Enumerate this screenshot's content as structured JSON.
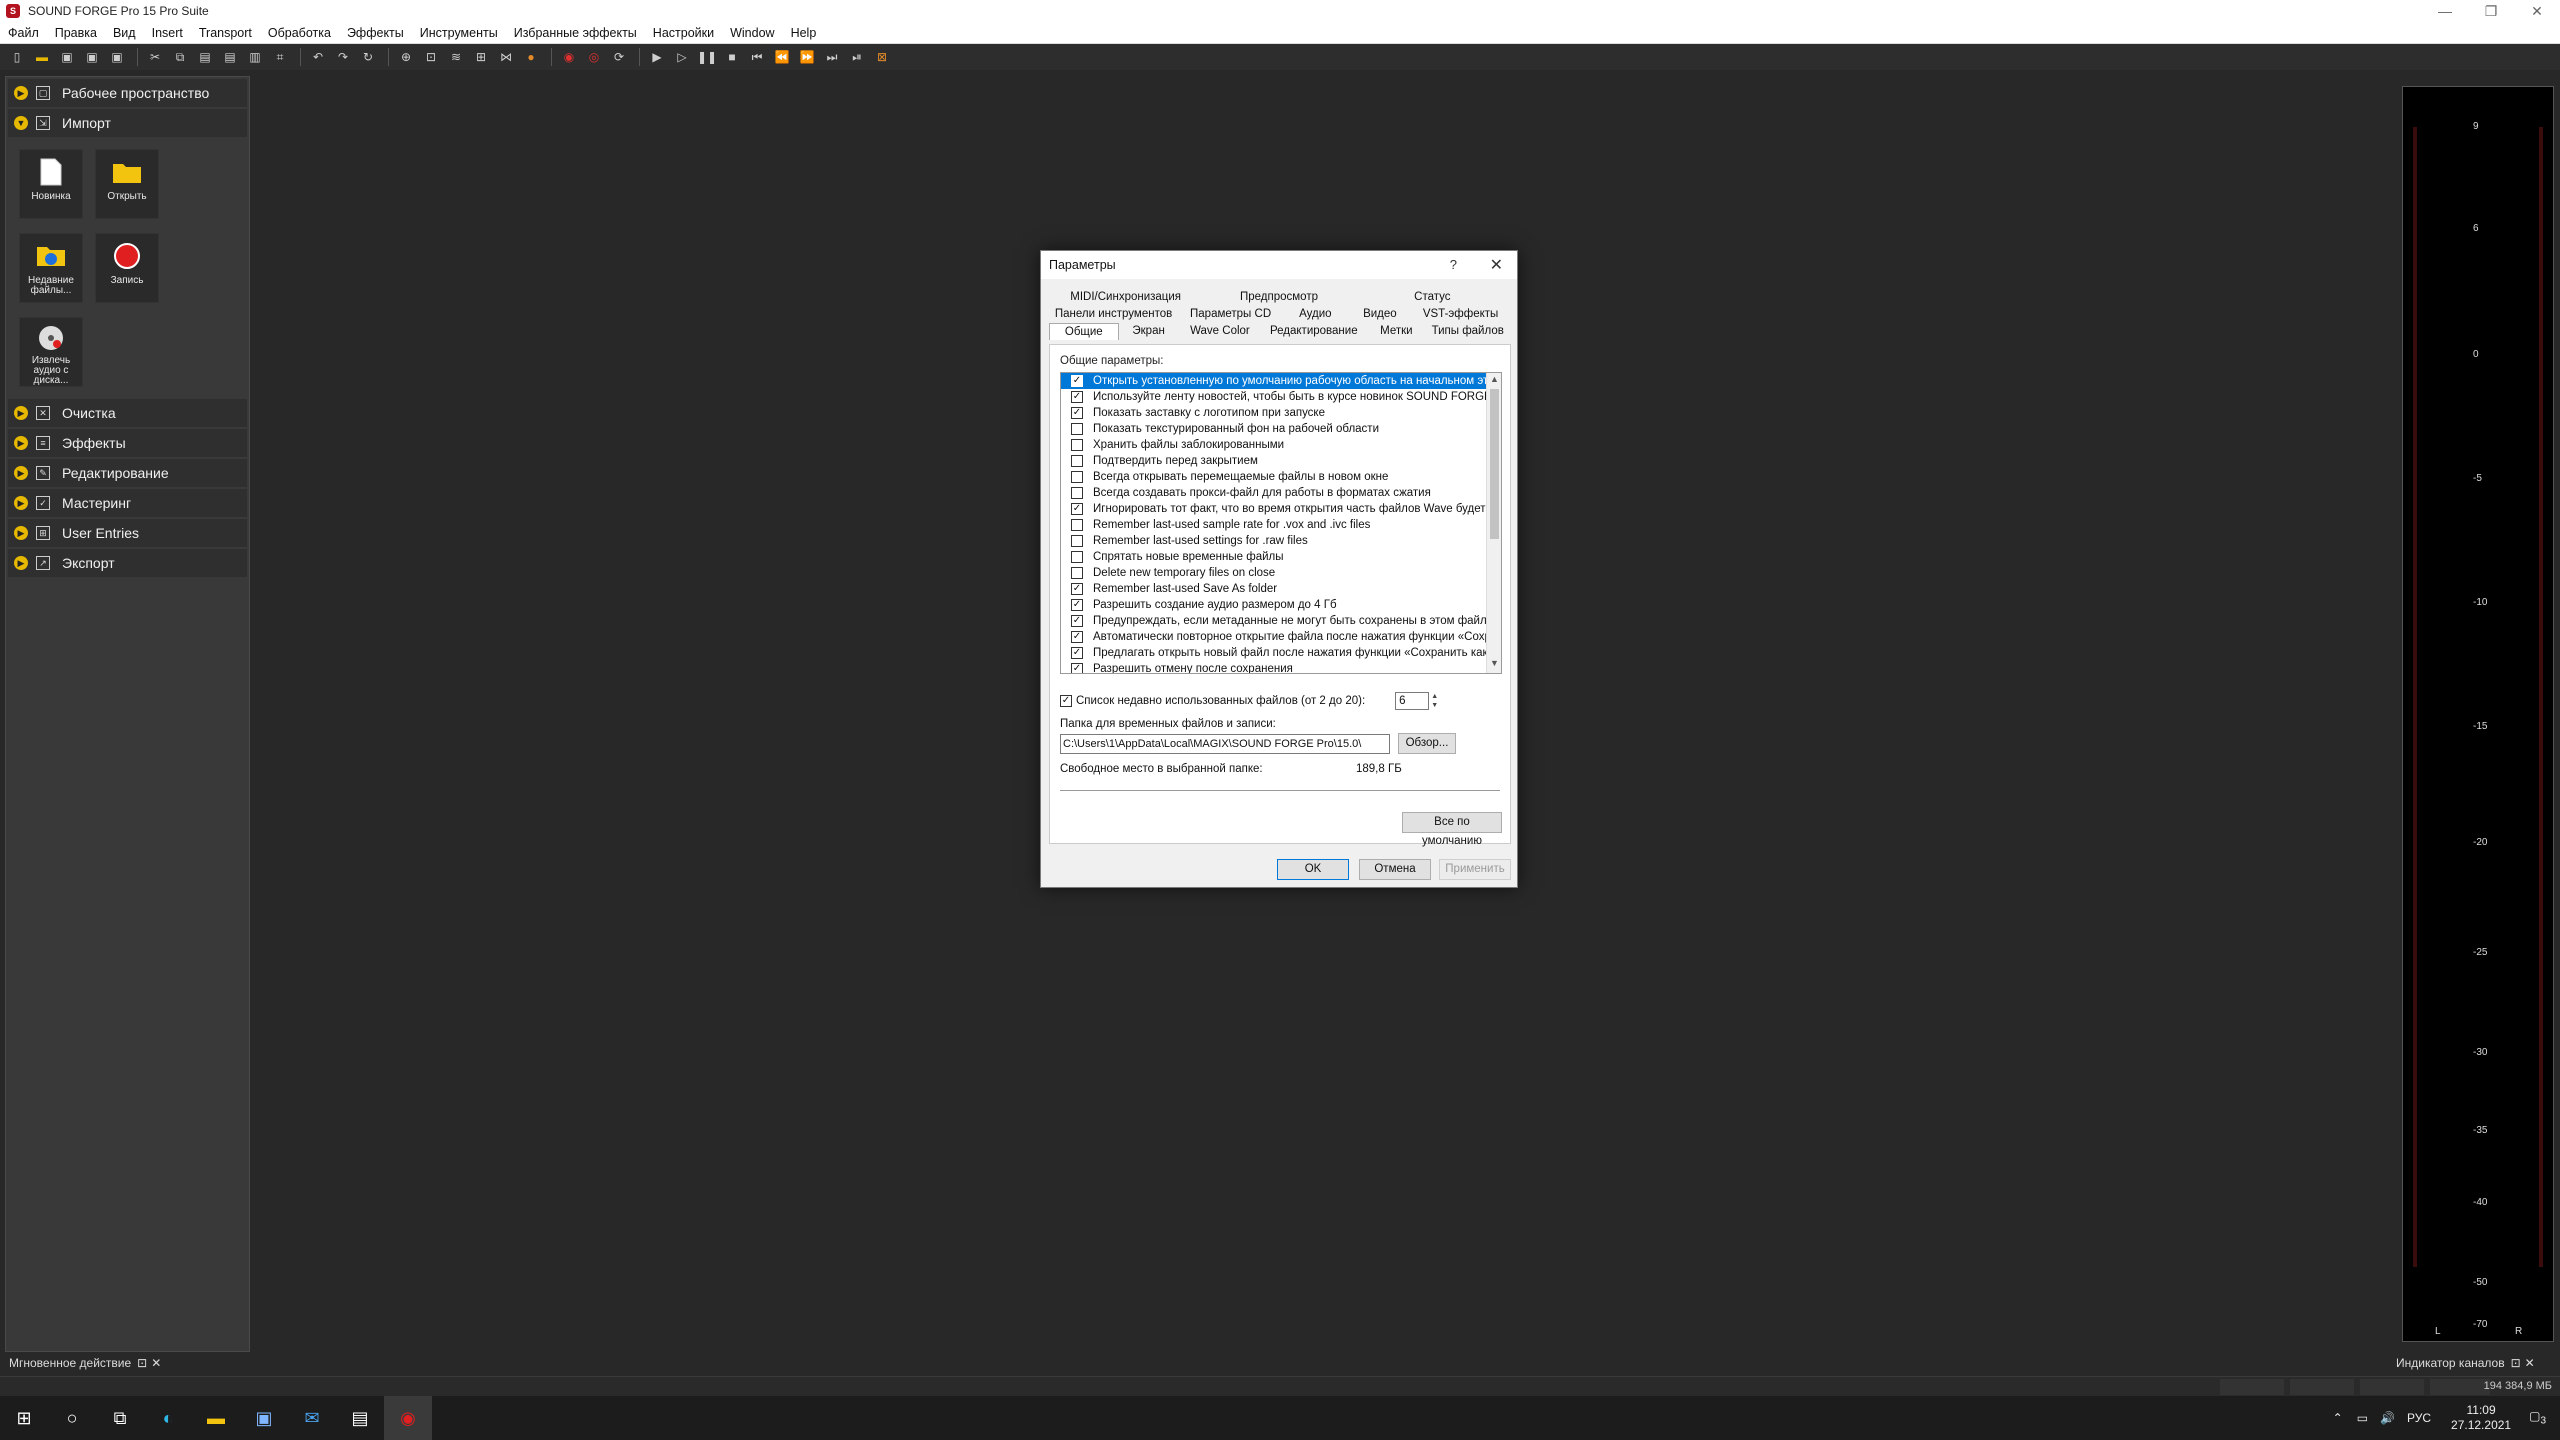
{
  "app": {
    "title": "SOUND FORGE Pro 15 Pro Suite",
    "icon_letter": "S",
    "window_buttons": [
      "—",
      "❐",
      "✕"
    ]
  },
  "menu": [
    "Файл",
    "Правка",
    "Вид",
    "Insert",
    "Transport",
    "Обработка",
    "Эффекты",
    "Инструменты",
    "Избранные эффекты",
    "Настройки",
    "Window",
    "Help"
  ],
  "left_panel": {
    "sections_top": [
      {
        "label": "Рабочее пространство",
        "icon": "workspace-icon"
      },
      {
        "label": "Импорт",
        "icon": "import-icon"
      }
    ],
    "tiles": [
      {
        "label": "Новинка",
        "icon": "new-file-icon"
      },
      {
        "label": "Открыть",
        "icon": "folder-open-icon"
      },
      {
        "label": "Недавние файлы...",
        "icon": "recent-files-icon"
      },
      {
        "label": "Запись",
        "icon": "record-icon"
      },
      {
        "label": "Извлечь аудио с диска...",
        "icon": "extract-cd-icon"
      }
    ],
    "sections_bottom": [
      {
        "label": "Очистка",
        "icon": "cleanup-icon"
      },
      {
        "label": "Эффекты",
        "icon": "effects-icon"
      },
      {
        "label": "Редактирование",
        "icon": "edit-icon"
      },
      {
        "label": "Мастеринг",
        "icon": "mastering-icon"
      },
      {
        "label": "User Entries",
        "icon": "user-entries-icon"
      },
      {
        "label": "Экспорт",
        "icon": "export-icon"
      }
    ]
  },
  "bottom": {
    "instant_action": "Мгновенное действие",
    "channel_meter": "Индикатор каналов",
    "memory": "194 384,9 МБ"
  },
  "meter": {
    "scale": [
      "0",
      "-5",
      "-10",
      "-15",
      "-20",
      "-25",
      "-30",
      "-35",
      "-40",
      "-50",
      "-70"
    ],
    "top_label": "0",
    "top_marks": [
      "9",
      "6"
    ],
    "left": "L",
    "right": "R"
  },
  "dialog": {
    "title": "Параметры",
    "help": "?",
    "close": "✕",
    "tabs_row1": [
      "MIDI/Синхронизация",
      "Предпросмотр",
      "Статус"
    ],
    "tabs_row2": [
      "Панели инструментов",
      "Параметры CD",
      "Аудио",
      "Видео",
      "VST-эффекты"
    ],
    "tabs_row3": [
      "Общие",
      "Экран",
      "Wave Color",
      "Редактирование",
      "Метки",
      "Типы файлов"
    ],
    "active_tab": "Общие",
    "group_label": "Общие параметры:",
    "options": [
      {
        "label": "Открыть установленную по умолчанию рабочую область на начальном эта",
        "checked": true,
        "selected": true
      },
      {
        "label": "Используйте ленту новостей, чтобы быть в курсе новинок SOUND FORGE",
        "checked": true
      },
      {
        "label": "Показать заставку с логотипом при запуске",
        "checked": true
      },
      {
        "label": "Показать текстурированный фон на рабочей области",
        "checked": false
      },
      {
        "label": "Хранить файлы заблокированными",
        "checked": false
      },
      {
        "label": "Подтвердить перед закрытием",
        "checked": false
      },
      {
        "label": "Всегда открывать перемещаемые файлы в новом окне",
        "checked": false
      },
      {
        "label": "Всегда создавать прокси-файл для работы в форматах сжатия",
        "checked": false
      },
      {
        "label": "Игнорировать тот факт, что  во время открытия часть  файлов Wave будет",
        "checked": true
      },
      {
        "label": "Remember last-used sample rate for .vox and .ivc files",
        "checked": false
      },
      {
        "label": "Remember last-used settings for .raw files",
        "checked": false
      },
      {
        "label": "Спрятать новые временные файлы",
        "checked": false
      },
      {
        "label": "Delete new temporary files on close",
        "checked": false
      },
      {
        "label": "Remember last-used Save As folder",
        "checked": true
      },
      {
        "label": "Разрешить создание аудио размером до 4 Гб",
        "checked": true
      },
      {
        "label": "Предупреждать, если метаданные не могут быть сохранены в этом файле",
        "checked": true
      },
      {
        "label": "Автоматически повторное открытие файла после нажатия функции «Сохра",
        "checked": true
      },
      {
        "label": "Предлагать открыть новый файл после нажатия функции «Сохранить как»",
        "checked": true
      },
      {
        "label": "Разрешить отмену после сохранения",
        "checked": true
      }
    ],
    "recent_files_label": "Список недавно использованных файлов (от 2 до 20):",
    "recent_files_checked": true,
    "recent_files_value": "6",
    "temp_folder_label": "Папка для временных файлов и записи:",
    "temp_folder_value": "C:\\Users\\1\\AppData\\Local\\MAGIX\\SOUND FORGE Pro\\15.0\\",
    "browse": "Обзор...",
    "free_space_label": "Свободное место в выбранной папке:",
    "free_space_value": "189,8 ГБ",
    "defaults": "Все по умолчанию",
    "ok": "OK",
    "cancel": "Отмена",
    "apply": "Применить"
  },
  "taskbar": {
    "lang": "РУС",
    "time": "11:09",
    "date": "27.12.2021",
    "notifications": "3"
  },
  "colors": {
    "workspace_bg": "#282828",
    "accent_selection": "#0078d7",
    "record_red": "#e02020",
    "folder_yellow": "#f2c40f"
  }
}
